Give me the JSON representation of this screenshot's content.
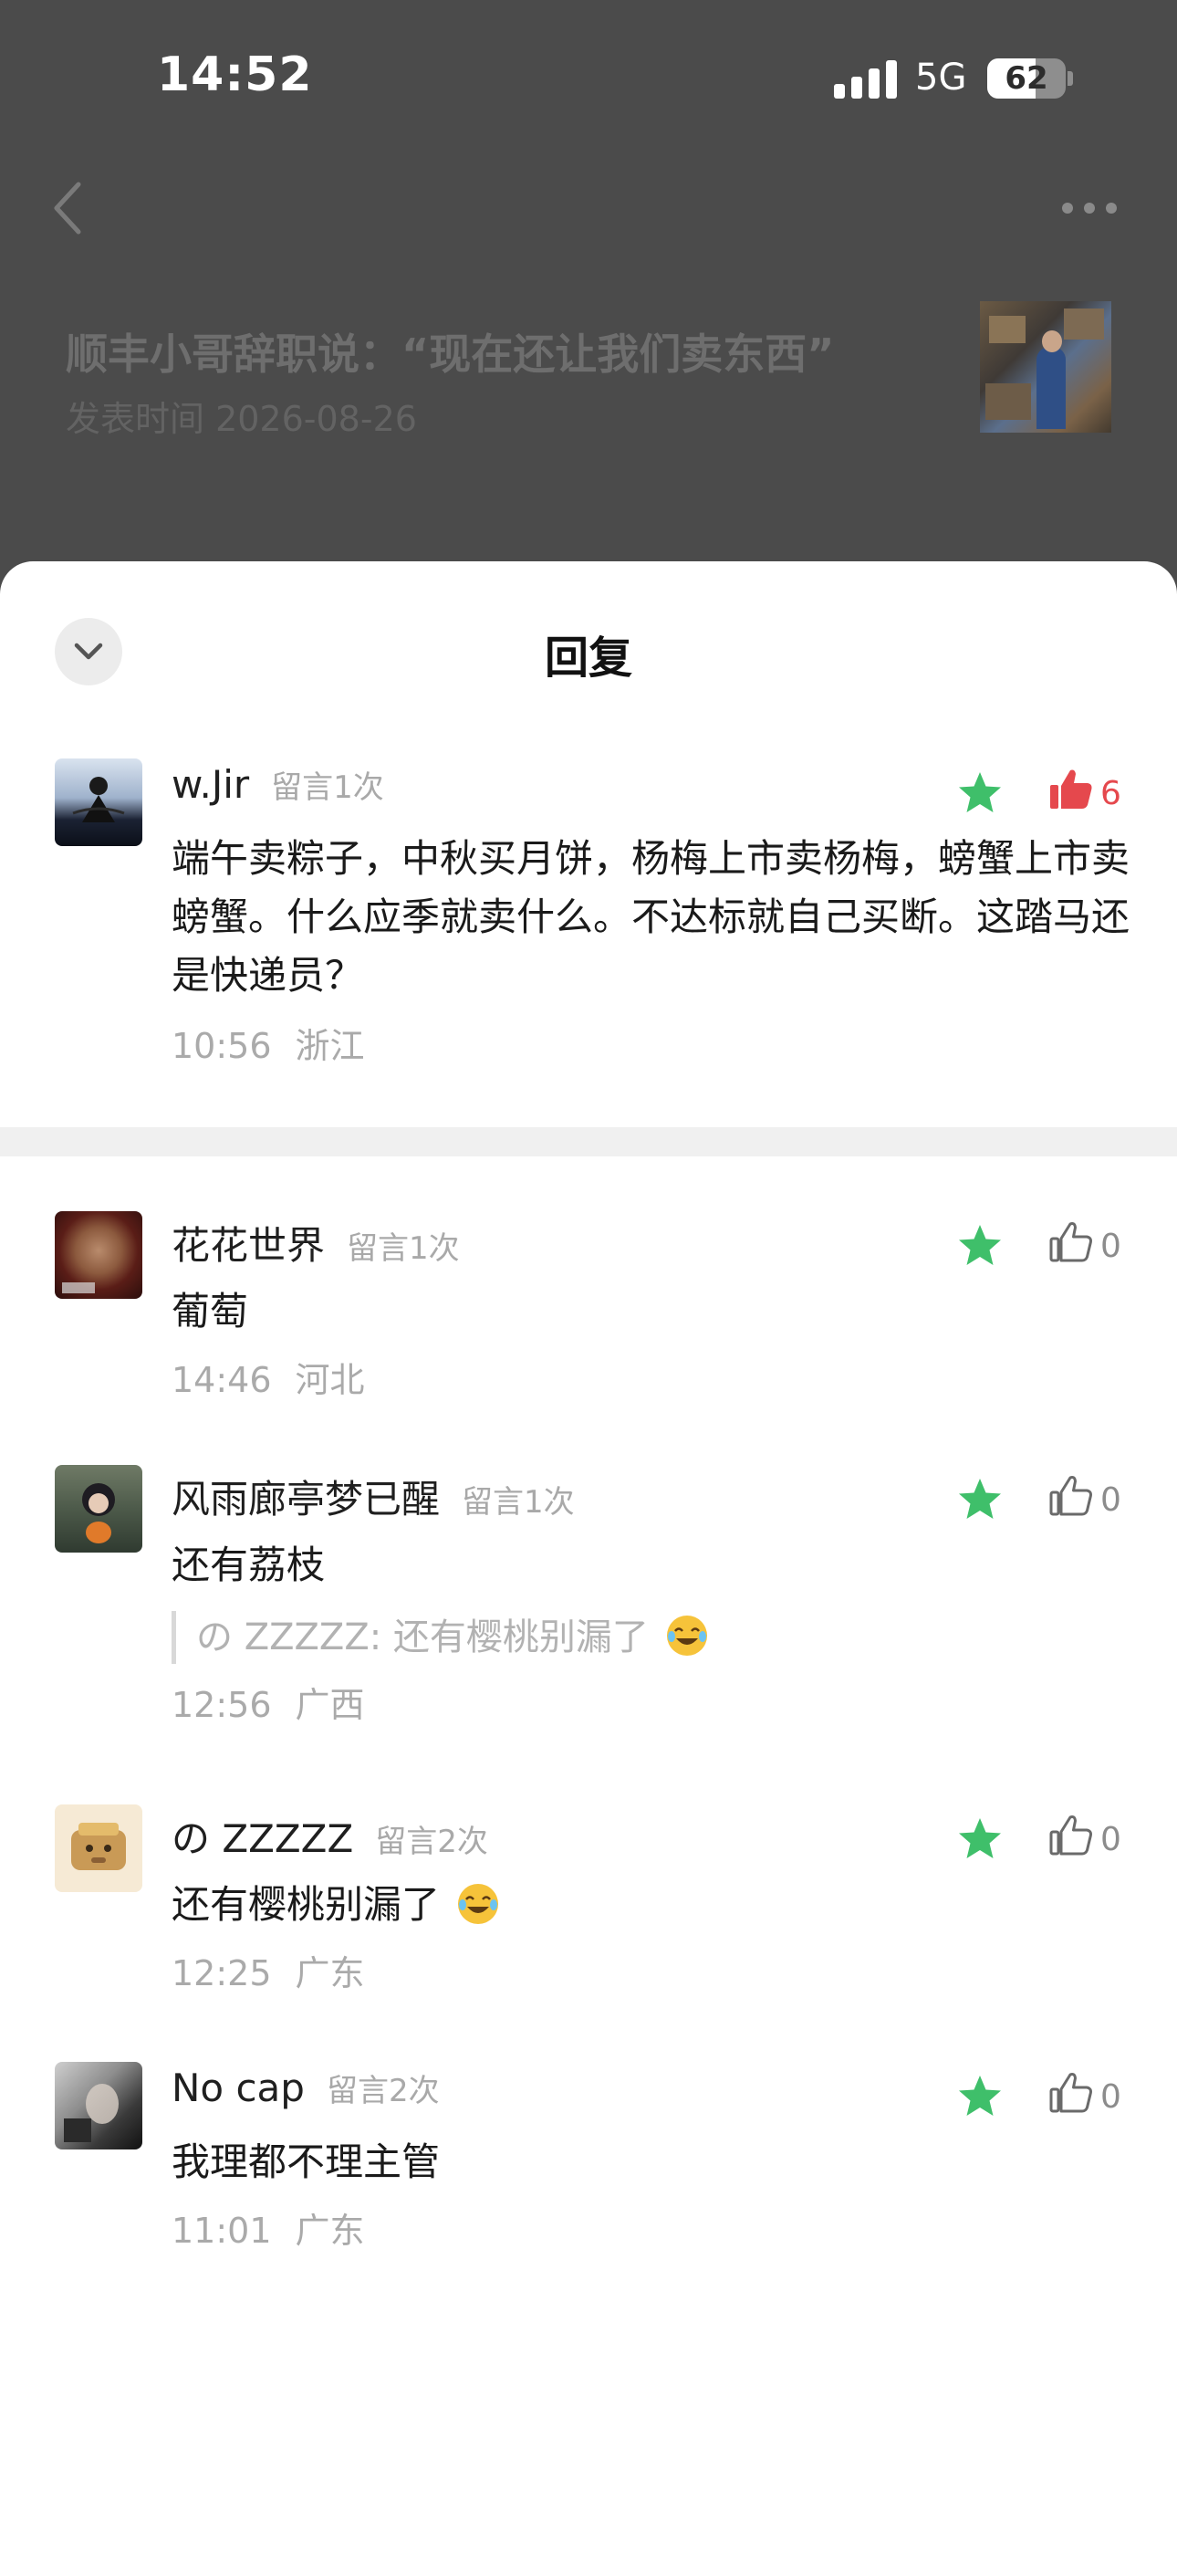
{
  "status_bar": {
    "time": "14:52",
    "network": "5G",
    "battery": "62",
    "battery_level": 0.62
  },
  "article": {
    "title": "顺丰小哥辞职说：“现在还让我们卖东西”",
    "date": "发表时间 2026-08-26"
  },
  "sheet": {
    "title": "回复"
  },
  "main_comment": {
    "name": "w.Jir",
    "count": "留言1次",
    "text": "端午卖粽子，中秋买月饼，杨梅上市卖杨梅，螃蟹上市卖螃蟹。什么应季就卖什么。不达标就自己买断。这踏马还是快递员？",
    "time": "10:56",
    "region": "浙江",
    "likes": "6"
  },
  "replies": [
    {
      "name": "花花世界",
      "count": "留言1次",
      "text": "葡萄",
      "time": "14:46",
      "region": "河北",
      "likes": "0"
    },
    {
      "name": "风雨廊亭梦已醒",
      "count": "留言1次",
      "text": "还有荔枝",
      "quote": "の ZZZZZ: 还有樱桃别漏了",
      "time": "12:56",
      "region": "广西",
      "likes": "0"
    },
    {
      "name": "の ZZZZZ",
      "count": "留言2次",
      "text": "还有樱桃别漏了",
      "time": "12:25",
      "region": "广东",
      "likes": "0"
    },
    {
      "name": "No cap",
      "count": "留言2次",
      "text": "我理都不理主管",
      "time": "11:01",
      "region": "广东",
      "likes": "0"
    }
  ],
  "colors": {
    "star": "#3fbf6a",
    "like_active": "#e5484d",
    "overlay": "#4b4b4b"
  },
  "icons": {
    "back": "chevron-left-icon",
    "more": "more-dots-icon",
    "collapse": "chevron-down-icon",
    "star": "star-icon",
    "like": "thumbs-up-icon",
    "emoji": "tears-of-joy-emoji"
  }
}
